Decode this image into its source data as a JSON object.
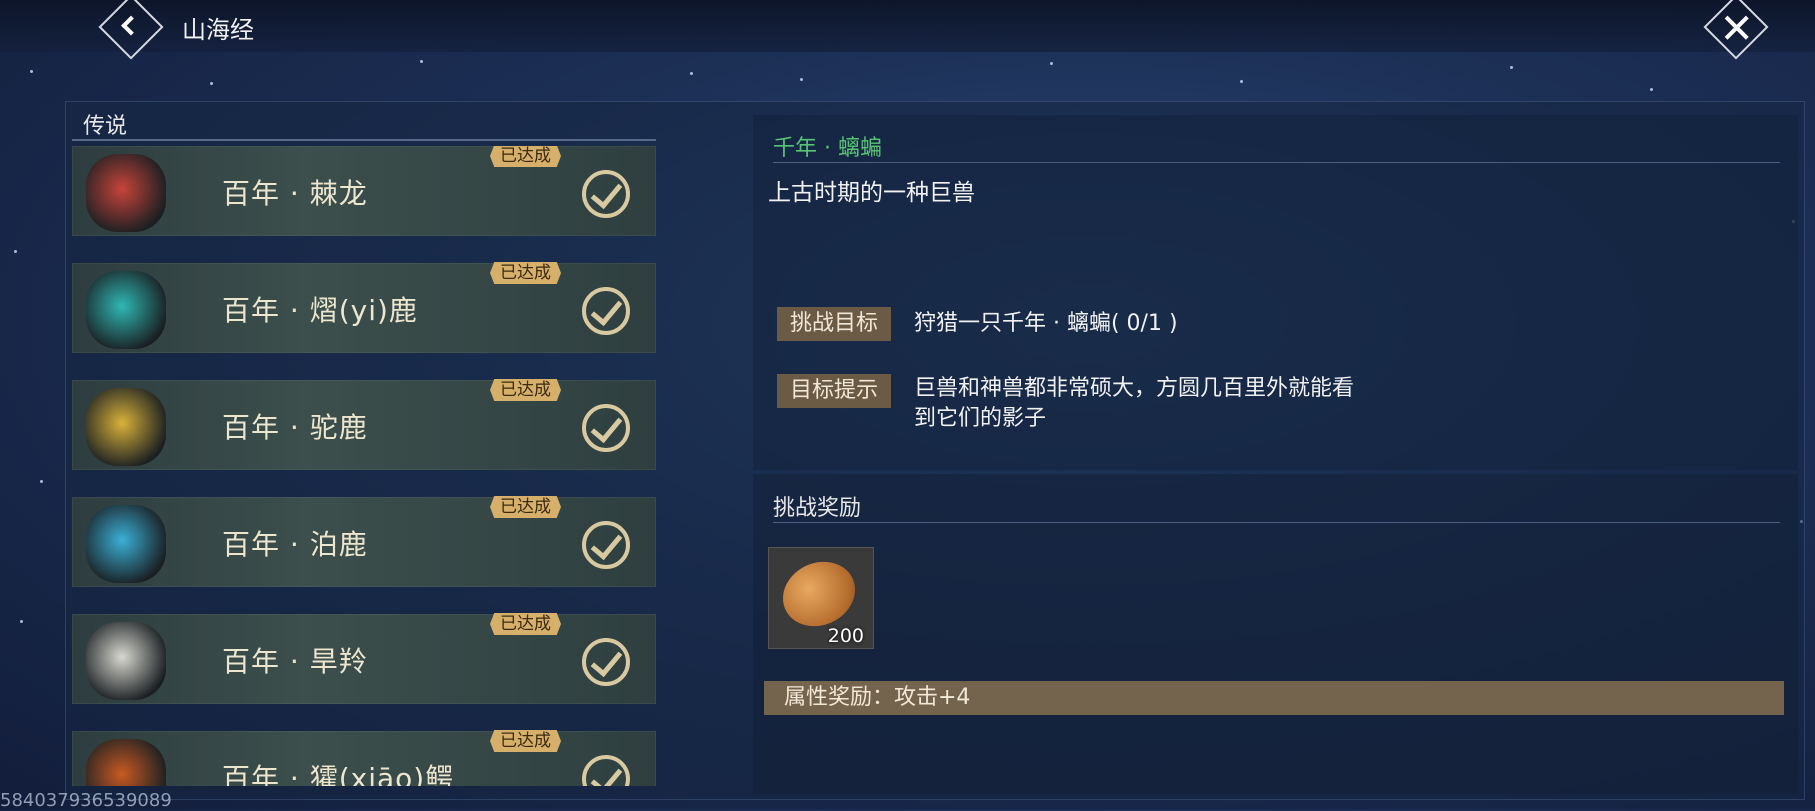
{
  "header": {
    "title": "山海经"
  },
  "left_panel": {
    "section_title": "传说",
    "items": [
      {
        "name": "百年 · 棘龙",
        "badge": "已达成",
        "portrait_color": "#c7443a"
      },
      {
        "name": "百年 · 熠(yi)鹿",
        "badge": "已达成",
        "portrait_color": "#2fb8b3"
      },
      {
        "name": "百年 · 驼鹿",
        "badge": "已达成",
        "portrait_color": "#d9b23a"
      },
      {
        "name": "百年 · 泊鹿",
        "badge": "已达成",
        "portrait_color": "#3ab0d6"
      },
      {
        "name": "百年 · 旱羚",
        "badge": "已达成",
        "portrait_color": "#d8d8d0"
      },
      {
        "name": "百年 · 㺢(xiāo)鳄",
        "badge": "已达成",
        "portrait_color": "#c85a22"
      }
    ]
  },
  "detail": {
    "title": "千年 · 螭蝙",
    "description": "上古时期的一种巨兽",
    "challenge_label": "挑战目标",
    "challenge_text": "狩猎一只千年 · 螭蝙( 0/1 )",
    "hint_label": "目标提示",
    "hint_line1": "巨兽和神兽都非常硕大，方圆几百里外就能看",
    "hint_line2": "到它们的影子"
  },
  "reward": {
    "title": "挑战奖励",
    "item_quantity": "200",
    "attribute_bonus": "属性奖励：攻击+4"
  },
  "footer": {
    "id_text": "584037936539089"
  },
  "colors": {
    "accent_green": "#58c474",
    "badge_gold": "#d6b06b",
    "tag_brown": "#6b5b45"
  }
}
